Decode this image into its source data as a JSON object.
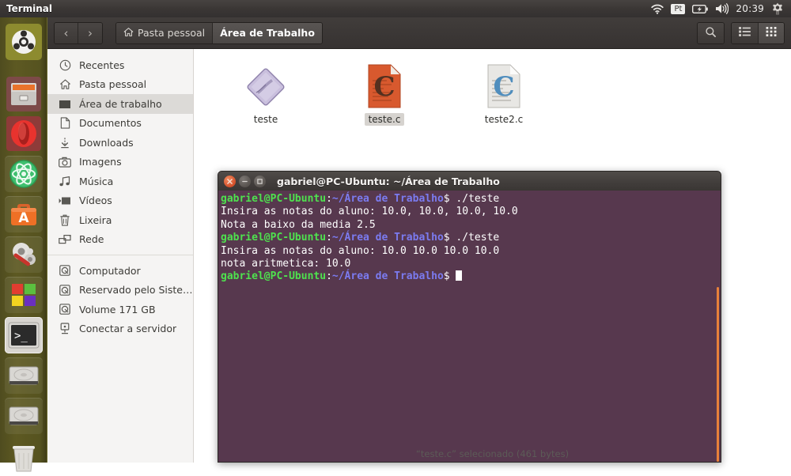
{
  "panel": {
    "app_title": "Terminal",
    "clock": "20:39",
    "tray": [
      {
        "name": "wifi-icon",
        "label": ""
      },
      {
        "name": "keyboard-layout-indicator",
        "label": "Pt"
      },
      {
        "name": "battery-icon",
        "label": ""
      },
      {
        "name": "volume-icon",
        "label": ""
      },
      {
        "name": "clock",
        "label": "20:39"
      },
      {
        "name": "system-menu-gear-icon",
        "label": ""
      }
    ]
  },
  "launcher": {
    "items": [
      {
        "name": "ubuntu-dash-icon",
        "label": "Dash inicial",
        "state": "normal"
      },
      {
        "name": "files-nautilus-icon",
        "label": "Arquivos",
        "state": "running"
      },
      {
        "name": "opera-browser-icon",
        "label": "Opera",
        "state": "running"
      },
      {
        "name": "atom-editor-icon",
        "label": "Atom",
        "state": "normal"
      },
      {
        "name": "ubuntu-software-icon",
        "label": "Central de Programas Ubuntu",
        "state": "normal"
      },
      {
        "name": "system-settings-icon",
        "label": "Configurações do sistema",
        "state": "normal"
      },
      {
        "name": "windows-tiles-icon",
        "label": "Windows",
        "state": "normal"
      },
      {
        "name": "terminal-icon",
        "label": "Terminal",
        "state": "focused"
      },
      {
        "name": "disk-volume-icon",
        "label": "Volume 171 GB",
        "state": "normal"
      },
      {
        "name": "disk-volume-2-icon",
        "label": "Reservado pelo Sistema",
        "state": "normal"
      },
      {
        "name": "trash-icon",
        "label": "Lixeira",
        "state": "normal"
      }
    ]
  },
  "nautilus": {
    "toolbar": {
      "back_label": "‹",
      "forward_label": "›",
      "breadcrumbs": [
        {
          "label": "Pasta pessoal",
          "active": false,
          "icon": "home-icon"
        },
        {
          "label": "Área de Trabalho",
          "active": true,
          "icon": ""
        }
      ],
      "search_label": "",
      "list_view_label": "",
      "grid_view_label": ""
    },
    "sidebar": {
      "items": [
        {
          "label": "Recentes",
          "icon": "clock-icon",
          "selected": false,
          "separator_before": false
        },
        {
          "label": "Pasta pessoal",
          "icon": "home-icon",
          "selected": false,
          "separator_before": false
        },
        {
          "label": "Área de trabalho",
          "icon": "folder-icon",
          "selected": true,
          "separator_before": false
        },
        {
          "label": "Documentos",
          "icon": "document-icon",
          "selected": false,
          "separator_before": false
        },
        {
          "label": "Downloads",
          "icon": "download-icon",
          "selected": false,
          "separator_before": false
        },
        {
          "label": "Imagens",
          "icon": "camera-icon",
          "selected": false,
          "separator_before": false
        },
        {
          "label": "Música",
          "icon": "music-note-icon",
          "selected": false,
          "separator_before": false
        },
        {
          "label": "Vídeos",
          "icon": "video-icon",
          "selected": false,
          "separator_before": false
        },
        {
          "label": "Lixeira",
          "icon": "trash-icon",
          "selected": false,
          "separator_before": false
        },
        {
          "label": "Rede",
          "icon": "network-icon",
          "selected": false,
          "separator_before": false
        },
        {
          "label": "Computador",
          "icon": "drive-icon",
          "selected": false,
          "separator_before": true
        },
        {
          "label": "Reservado pelo Sistema",
          "icon": "drive-icon",
          "selected": false,
          "separator_before": false
        },
        {
          "label": "Volume 171 GB",
          "icon": "drive-icon",
          "selected": false,
          "separator_before": false
        },
        {
          "label": "Conectar a servidor",
          "icon": "server-icon",
          "selected": false,
          "separator_before": false
        }
      ]
    },
    "files": [
      {
        "name": "teste",
        "icon": "executable-icon",
        "selected": false
      },
      {
        "name": "teste.c",
        "icon": "c-source-icon",
        "selected": true
      },
      {
        "name": "teste2.c",
        "icon": "c-source-alt-icon",
        "selected": false
      }
    ],
    "statusbar": {
      "text": "“teste.c” selecionado (461 bytes)"
    }
  },
  "terminal": {
    "title": "gabriel@PC-Ubuntu: ~/Área de Trabalho",
    "prompt_user": "gabriel@PC-Ubuntu",
    "prompt_path": "~/Área de Trabalho",
    "prompt_sep": ":",
    "prompt_end": "$",
    "lines": [
      {
        "type": "prompt",
        "command": " ./teste"
      },
      {
        "type": "output",
        "text": "Insira as notas do aluno: 10.0, 10.0, 10.0, 10.0"
      },
      {
        "type": "output",
        "text": "Nota a baixo da media 2.5"
      },
      {
        "type": "prompt",
        "command": " ./teste"
      },
      {
        "type": "output",
        "text": "Insira as notas do aluno: 10.0 10.0 10.0 10.0"
      },
      {
        "type": "output",
        "text": "nota aritmetica: 10.0"
      },
      {
        "type": "prompt-cursor",
        "command": " "
      }
    ],
    "colors": {
      "background": "#57384e",
      "user": "#4ee24e",
      "path": "#7b7bf0",
      "text": "#ffffff",
      "scrollbar": "#e8813a"
    }
  }
}
